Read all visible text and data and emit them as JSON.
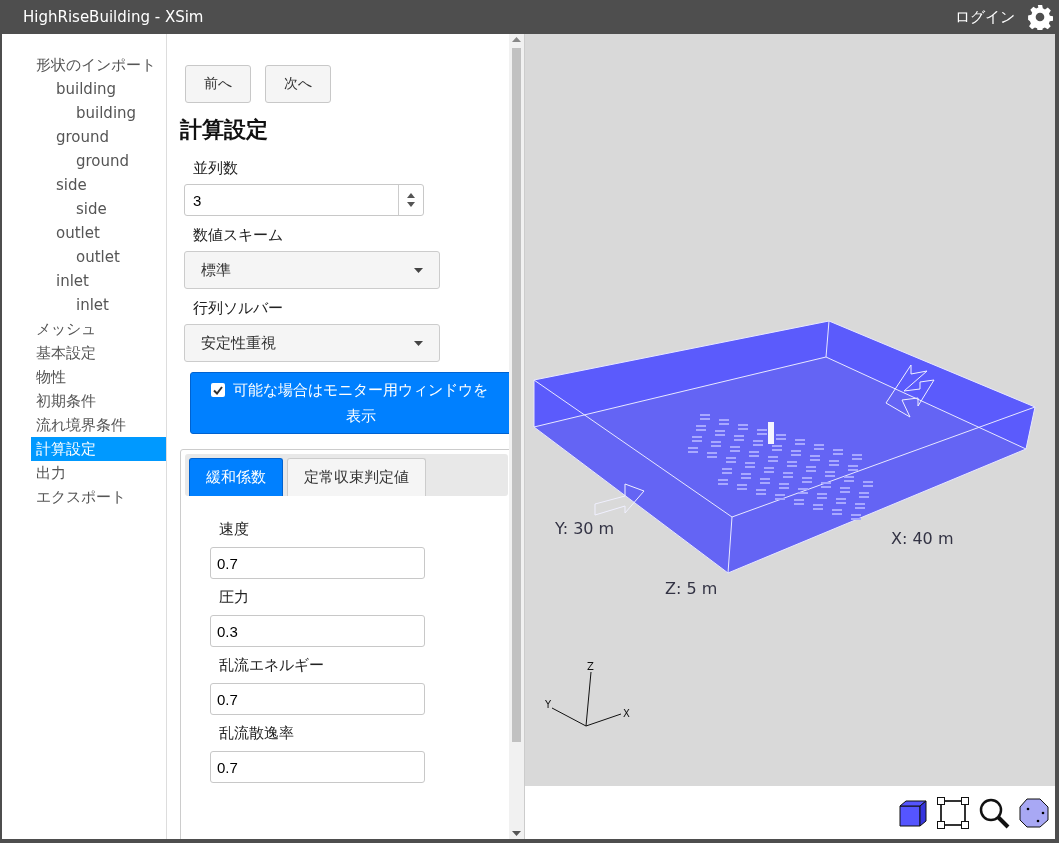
{
  "window": {
    "title": "HighRiseBuilding - XSim",
    "login": "ログイン"
  },
  "sidebar": {
    "items": [
      {
        "label": "形状のインポート",
        "selected": false,
        "children": [
          {
            "label": "building",
            "selected": false,
            "children": [
              {
                "label": "building",
                "selected": false
              }
            ]
          },
          {
            "label": "ground",
            "selected": false,
            "children": [
              {
                "label": "ground",
                "selected": false
              }
            ]
          },
          {
            "label": "side",
            "selected": false,
            "children": [
              {
                "label": "side",
                "selected": false
              }
            ]
          },
          {
            "label": "outlet",
            "selected": false,
            "children": [
              {
                "label": "outlet",
                "selected": false
              }
            ]
          },
          {
            "label": "inlet",
            "selected": false,
            "children": [
              {
                "label": "inlet",
                "selected": false
              }
            ]
          }
        ]
      },
      {
        "label": "メッシュ",
        "selected": false
      },
      {
        "label": "基本設定",
        "selected": false
      },
      {
        "label": "物性",
        "selected": false
      },
      {
        "label": "初期条件",
        "selected": false
      },
      {
        "label": "流れ境界条件",
        "selected": false
      },
      {
        "label": "計算設定",
        "selected": true
      },
      {
        "label": "出力",
        "selected": false
      },
      {
        "label": "エクスポート",
        "selected": false
      }
    ]
  },
  "nav_buttons": [
    "前へ",
    "次へ"
  ],
  "heading": "計算設定",
  "fields": [
    {
      "kind": "spinner",
      "label": "並列数",
      "value": "3"
    },
    {
      "kind": "select",
      "label": "数値スキーム",
      "value": "標準"
    },
    {
      "kind": "select",
      "label": "行列ソルバー",
      "value": "安定性重視"
    }
  ],
  "monitor_toggle": {
    "label": "可能な場合はモニター用ウィンドウを表示",
    "checked": true
  },
  "tabs": [
    {
      "label": "緩和係数",
      "selected": true
    },
    {
      "label": "定常収束判定値",
      "selected": false
    }
  ],
  "relaxation": [
    {
      "label": "速度",
      "value": "0.7"
    },
    {
      "label": "圧力",
      "value": "0.3"
    },
    {
      "label": "乱流エネルギー",
      "value": "0.7"
    },
    {
      "label": "乱流散逸率",
      "value": "0.7"
    }
  ],
  "viewport": {
    "dimensions": {
      "y": "Y: 30 m",
      "x": "X: 40 m",
      "z": "Z: 5 m"
    },
    "axes": {
      "z": "Z",
      "y": "Y",
      "x": "X"
    }
  }
}
